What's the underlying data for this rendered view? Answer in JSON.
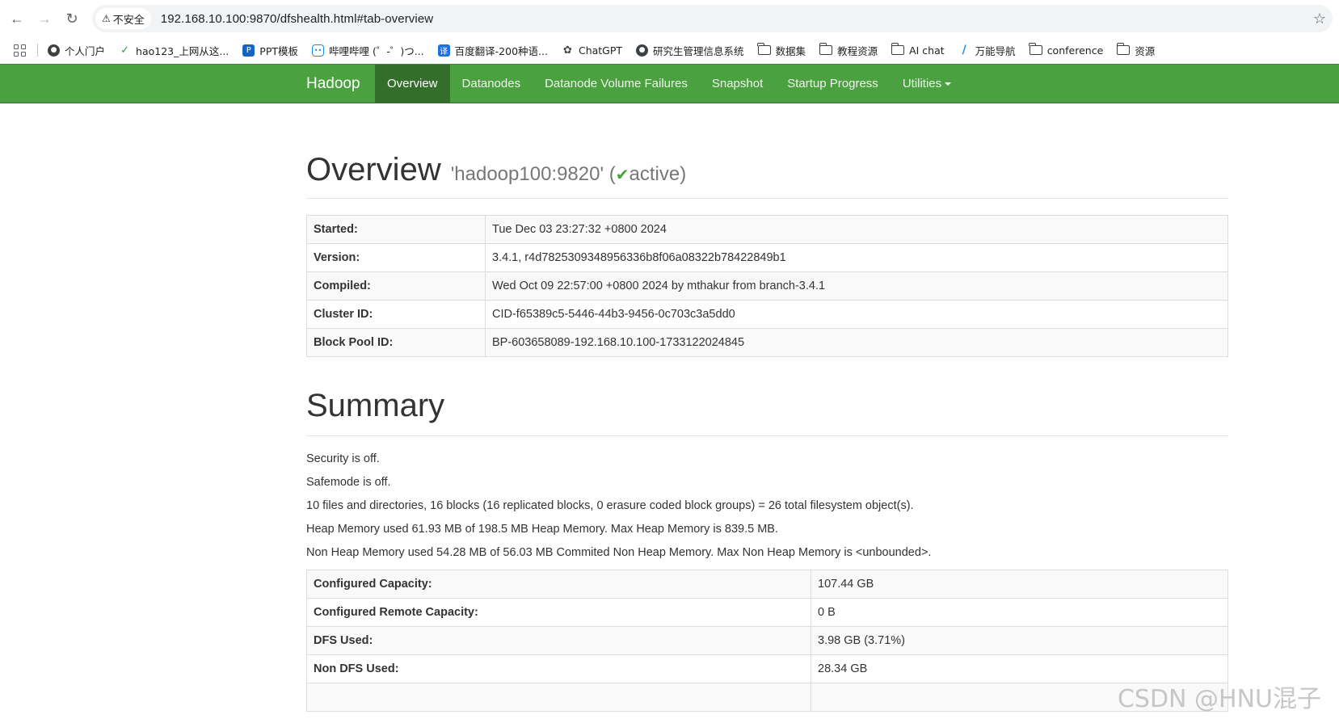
{
  "browser": {
    "security_label": "不安全",
    "url": "192.168.10.100:9870/dfshealth.html#tab-overview",
    "bookmarks": [
      {
        "label": "个人门户",
        "icon": "globe-icon"
      },
      {
        "label": "hao123_上网从这...",
        "icon": "hao123-icon"
      },
      {
        "label": "PPT模板",
        "icon": "ppt-icon"
      },
      {
        "label": "哔哩哔哩 (゜-゜)つ...",
        "icon": "bilibili-icon"
      },
      {
        "label": "百度翻译-200种语...",
        "icon": "translate-icon"
      },
      {
        "label": "ChatGPT",
        "icon": "chatgpt-icon"
      },
      {
        "label": "研究生管理信息系统",
        "icon": "globe-icon"
      },
      {
        "label": "数据集",
        "icon": "folder-icon"
      },
      {
        "label": "教程资源",
        "icon": "folder-icon"
      },
      {
        "label": "AI chat",
        "icon": "folder-icon"
      },
      {
        "label": "万能导航",
        "icon": "navigation-icon"
      },
      {
        "label": "conference",
        "icon": "folder-icon"
      },
      {
        "label": "资源",
        "icon": "folder-icon"
      }
    ]
  },
  "navbar": {
    "brand": "Hadoop",
    "items": [
      "Overview",
      "Datanodes",
      "Datanode Volume Failures",
      "Snapshot",
      "Startup Progress",
      "Utilities"
    ],
    "active": "Overview"
  },
  "overview": {
    "title": "Overview",
    "host": "'hadoop100:9820'",
    "state_open": "(",
    "state": "active)",
    "rows": [
      {
        "key": "Started:",
        "value": "Tue Dec 03 23:27:32 +0800 2024"
      },
      {
        "key": "Version:",
        "value": "3.4.1, r4d7825309348956336b8f06a08322b78422849b1"
      },
      {
        "key": "Compiled:",
        "value": "Wed Oct 09 22:57:00 +0800 2024 by mthakur from branch-3.4.1"
      },
      {
        "key": "Cluster ID:",
        "value": "CID-f65389c5-5446-44b3-9456-0c703c3a5dd0"
      },
      {
        "key": "Block Pool ID:",
        "value": "BP-603658089-192.168.10.100-1733122024845"
      }
    ]
  },
  "summary": {
    "title": "Summary",
    "lines": [
      "Security is off.",
      "Safemode is off.",
      "10 files and directories, 16 blocks (16 replicated blocks, 0 erasure coded block groups) = 26 total filesystem object(s).",
      "Heap Memory used 61.93 MB of 198.5 MB Heap Memory. Max Heap Memory is 839.5 MB.",
      "Non Heap Memory used 54.28 MB of 56.03 MB Commited Non Heap Memory. Max Non Heap Memory is <unbounded>."
    ],
    "rows": [
      {
        "key": "Configured Capacity:",
        "value": "107.44 GB"
      },
      {
        "key": "Configured Remote Capacity:",
        "value": "0 B"
      },
      {
        "key": "DFS Used:",
        "value": "3.98 GB (3.71%)"
      },
      {
        "key": "Non DFS Used:",
        "value": "28.34 GB"
      },
      {
        "key": "",
        "value": ""
      }
    ]
  },
  "watermark": "CSDN @HNU混子"
}
